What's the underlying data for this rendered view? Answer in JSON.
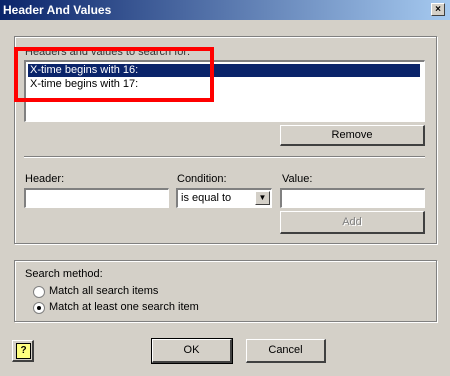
{
  "window": {
    "title": "Header And Values",
    "close_glyph": "×"
  },
  "search_box": {
    "label": "Headers and values to search for:",
    "items": [
      {
        "text": "X-time begins with 16:",
        "selected": true
      },
      {
        "text": "X-time begins with 17:",
        "selected": false
      }
    ],
    "remove_label": "Remove"
  },
  "form": {
    "header_label": "Header:",
    "header_value": "",
    "condition_label": "Condition:",
    "condition_value": "is equal to",
    "value_label": "Value:",
    "value_value": "",
    "add_label": "Add"
  },
  "search_method": {
    "label": "Search method:",
    "options": [
      {
        "text": "Match all search items",
        "selected": false
      },
      {
        "text": "Match at least one search item",
        "selected": true
      }
    ]
  },
  "footer": {
    "ok_label": "OK",
    "cancel_label": "Cancel",
    "help_icon": "help-icon"
  },
  "colors": {
    "highlight": "#ff0000",
    "selection": "#0a246a",
    "face": "#d4d0c8"
  }
}
